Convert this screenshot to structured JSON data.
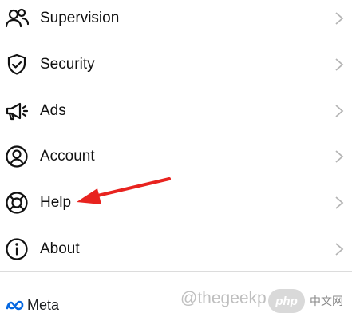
{
  "menu": {
    "items": [
      {
        "label": "Supervision",
        "icon": "supervision-people-icon"
      },
      {
        "label": "Security",
        "icon": "shield-check-icon"
      },
      {
        "label": "Ads",
        "icon": "megaphone-icon"
      },
      {
        "label": "Account",
        "icon": "account-circle-icon"
      },
      {
        "label": "Help",
        "icon": "lifebuoy-icon"
      },
      {
        "label": "About",
        "icon": "info-icon"
      }
    ]
  },
  "footer": {
    "brand": "Meta",
    "watermark": "@thegeekp",
    "badge": "php",
    "cn_text": "中文网"
  },
  "colors": {
    "arrow": "#e8231f",
    "meta_blue": "#0668e1",
    "chevron": "#b5b5b5"
  }
}
